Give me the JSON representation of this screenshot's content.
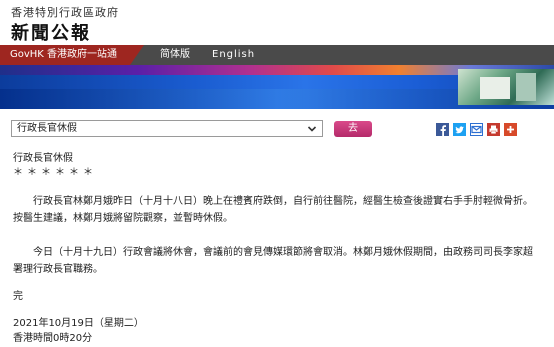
{
  "header": {
    "government_name": "香港特別行政區政府",
    "site_title": "新聞公報"
  },
  "nav": {
    "govhk_label": "GovHK 香港政府一站通",
    "simplified_label": "简体版",
    "english_label": "English"
  },
  "toolbar": {
    "category_select_value": "行政長官休假",
    "go_button_label": "去",
    "share_icons": [
      "facebook-icon",
      "twitter-icon",
      "email-icon",
      "print-icon",
      "plus-icon"
    ]
  },
  "article": {
    "title": "行政長官休假",
    "stars": "＊＊＊＊＊＊",
    "paragraphs": [
      "行政長官林鄭月娥昨日（十月十八日）晚上在禮賓府跌倒，自行前往醫院，經醫生檢查後證實右手手肘輕微骨折。按醫生建議，林鄭月娥將留院觀察，並暫時休假。",
      "今日（十月十九日）行政會議將休會，會議前的會見傳媒環節將會取消。林鄭月娥休假期間，由政務司司長李家超署理行政長官職務。"
    ],
    "end_mark": "完",
    "date": "2021年10月19日（星期二）",
    "time": "香港時間0時20分"
  },
  "colors": {
    "govhk_red": "#9e2620",
    "navbar_gray": "#4a4a4a",
    "go_button_pink": "#c2367a",
    "banner_blue": "#1a5cd0"
  }
}
